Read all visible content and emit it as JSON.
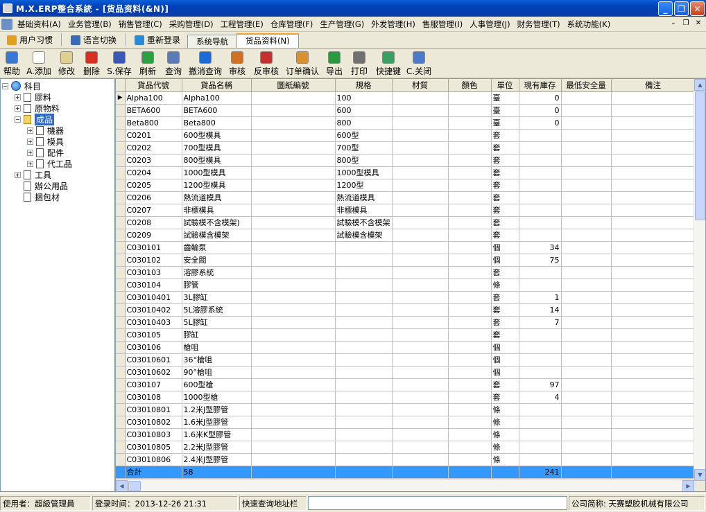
{
  "window": {
    "title": "M.X.ERP整合系統 - [货品资料(&N)]"
  },
  "menu": [
    "基础资料(A)",
    "业务管理(B)",
    "销售管理(C)",
    "采购管理(D)",
    "工程管理(E)",
    "仓库管理(F)",
    "生产管理(G)",
    "外发管理(H)",
    "售服管理(I)",
    "人事管理(J)",
    "财务管理(T)",
    "系统功能(K)"
  ],
  "quickbar": {
    "habit": "用户习惯",
    "lang": "语言切换",
    "relogin": "重新登录"
  },
  "tabs": [
    "系统导航",
    "货品资料(N)"
  ],
  "toolbar": [
    "帮助",
    "A.添加",
    "修改",
    "删除",
    "S.保存",
    "刷新",
    "查询",
    "撤消查询",
    "审核",
    "反审核",
    "订单确认",
    "导出",
    "打印",
    "快捷键",
    "C.关闭"
  ],
  "tree": {
    "root": "科目",
    "items": [
      {
        "label": "膠料",
        "level": 1,
        "expander": "+"
      },
      {
        "label": "原物料",
        "level": 1,
        "expander": "+"
      },
      {
        "label": "成品",
        "level": 1,
        "expander": "-",
        "selected": true
      },
      {
        "label": "機器",
        "level": 2,
        "expander": "+"
      },
      {
        "label": "模具",
        "level": 2,
        "expander": "+"
      },
      {
        "label": "配件",
        "level": 2,
        "expander": "+"
      },
      {
        "label": "代工品",
        "level": 2,
        "expander": "+"
      },
      {
        "label": "工具",
        "level": 1,
        "expander": "+"
      },
      {
        "label": "辦公用品",
        "level": 1,
        "expander": ""
      },
      {
        "label": "捆包材",
        "level": 1,
        "expander": ""
      }
    ]
  },
  "table": {
    "columns": [
      "貨品代號",
      "貨品名稱",
      "圖紙編號",
      "規格",
      "材質",
      "顏色",
      "單位",
      "現有庫存",
      "最低安全量",
      "備注"
    ],
    "rows": [
      [
        "Alpha100",
        "Alpha100",
        "",
        "100",
        "",
        "",
        "臺",
        "0",
        "",
        ""
      ],
      [
        "BETA600",
        "BETA600",
        "",
        "600",
        "",
        "",
        "臺",
        "0",
        "",
        ""
      ],
      [
        "Beta800",
        "Beta800",
        "",
        "800",
        "",
        "",
        "臺",
        "0",
        "",
        ""
      ],
      [
        "C0201",
        "600型模具",
        "",
        "600型",
        "",
        "",
        "套",
        "",
        "",
        ""
      ],
      [
        "C0202",
        "700型模具",
        "",
        "700型",
        "",
        "",
        "套",
        "",
        "",
        ""
      ],
      [
        "C0203",
        "800型模具",
        "",
        "800型",
        "",
        "",
        "套",
        "",
        "",
        ""
      ],
      [
        "C0204",
        "1000型模具",
        "",
        "1000型模具",
        "",
        "",
        "套",
        "",
        "",
        ""
      ],
      [
        "C0205",
        "1200型模具",
        "",
        "1200型",
        "",
        "",
        "套",
        "",
        "",
        ""
      ],
      [
        "C0206",
        "熱流道模具",
        "",
        "熱流道模具",
        "",
        "",
        "套",
        "",
        "",
        ""
      ],
      [
        "C0207",
        "非標模具",
        "",
        "非標模具",
        "",
        "",
        "套",
        "",
        "",
        ""
      ],
      [
        "C0208",
        "試驗模不含模架)",
        "",
        "試驗模不含模架",
        "",
        "",
        "套",
        "",
        "",
        ""
      ],
      [
        "C0209",
        "試驗模含模架",
        "",
        "試驗模含模架",
        "",
        "",
        "套",
        "",
        "",
        ""
      ],
      [
        "C030101",
        "齒輪泵",
        "",
        "",
        "",
        "",
        "個",
        "34",
        "",
        ""
      ],
      [
        "C030102",
        "安全閥",
        "",
        "",
        "",
        "",
        "個",
        "75",
        "",
        ""
      ],
      [
        "C030103",
        "溶膠系統",
        "",
        "",
        "",
        "",
        "套",
        "",
        "",
        ""
      ],
      [
        "C030104",
        "膠管",
        "",
        "",
        "",
        "",
        "條",
        "",
        "",
        ""
      ],
      [
        "C03010401",
        "3L膠缸",
        "",
        "",
        "",
        "",
        "套",
        "1",
        "",
        ""
      ],
      [
        "C03010402",
        "5L溶膠系統",
        "",
        "",
        "",
        "",
        "套",
        "14",
        "",
        ""
      ],
      [
        "C03010403",
        "5L膠缸",
        "",
        "",
        "",
        "",
        "套",
        "7",
        "",
        ""
      ],
      [
        "C030105",
        "膠缸",
        "",
        "",
        "",
        "",
        "套",
        "",
        "",
        ""
      ],
      [
        "C030106",
        "槍咀",
        "",
        "",
        "",
        "",
        "個",
        "",
        "",
        ""
      ],
      [
        "C03010601",
        "36°槍咀",
        "",
        "",
        "",
        "",
        "個",
        "",
        "",
        ""
      ],
      [
        "C03010602",
        "90°槍咀",
        "",
        "",
        "",
        "",
        "個",
        "",
        "",
        ""
      ],
      [
        "C030107",
        "600型槍",
        "",
        "",
        "",
        "",
        "套",
        "97",
        "",
        ""
      ],
      [
        "C030108",
        "1000型槍",
        "",
        "",
        "",
        "",
        "套",
        "4",
        "",
        ""
      ],
      [
        "C03010801",
        "1.2米J型膠管",
        "",
        "",
        "",
        "",
        "條",
        "",
        "",
        ""
      ],
      [
        "C03010802",
        "1.6米J型膠管",
        "",
        "",
        "",
        "",
        "條",
        "",
        "",
        ""
      ],
      [
        "C03010803",
        "1.6米K型膠管",
        "",
        "",
        "",
        "",
        "條",
        "",
        "",
        ""
      ],
      [
        "C03010805",
        "2.2米J型膠管",
        "",
        "",
        "",
        "",
        "條",
        "",
        "",
        ""
      ],
      [
        "C03010806",
        "2.4米J型膠管",
        "",
        "",
        "",
        "",
        "條",
        "",
        "",
        ""
      ]
    ],
    "total": {
      "label": "合計",
      "count": "58",
      "stock": "241"
    }
  },
  "status": {
    "user": "使用者：超級管理員",
    "login": "登录时间：2013-12-26 21:31",
    "quick": "快速查询地址栏",
    "company": "公司简称: 天赛塑胶机械有限公司"
  },
  "colors": {
    "selection": "#316ac5",
    "total_row": "#3399ff",
    "title_bar": "#0a5fd8"
  }
}
